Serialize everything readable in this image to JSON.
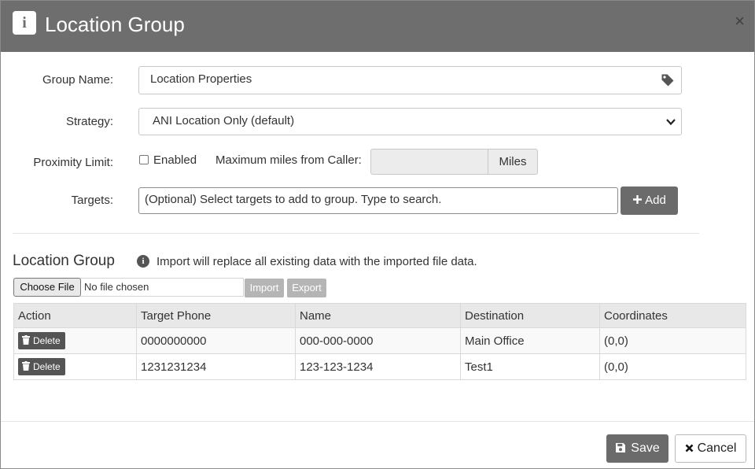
{
  "dialog": {
    "title": "Location Group",
    "header_icon": "info-icon",
    "close_glyph": "×"
  },
  "form": {
    "group_name_label": "Group Name:",
    "group_name_value": "Location Properties",
    "strategy_label": "Strategy:",
    "strategy_value": "ANI Location Only (default)",
    "proximity_label": "Proximity Limit:",
    "enabled_label": "Enabled",
    "enabled_checked": false,
    "max_miles_label": "Maximum miles from Caller:",
    "max_miles_value": "",
    "miles_addon": "Miles",
    "targets_label": "Targets:",
    "targets_placeholder": "(Optional) Select targets to add to group. Type to search.",
    "add_label": "Add"
  },
  "section": {
    "title": "Location Group",
    "import_note": "Import will replace all existing data with the imported file data.",
    "choose_file_label": "Choose File",
    "no_file_text": "No file chosen",
    "import_label": "Import",
    "export_label": "Export"
  },
  "table": {
    "columns": [
      "Action",
      "Target Phone",
      "Name",
      "Destination",
      "Coordinates"
    ],
    "rows": [
      {
        "action": "Delete",
        "target_phone": "0000000000",
        "name": "000-000-0000",
        "destination": "Main Office",
        "coordinates": "(0,0)"
      },
      {
        "action": "Delete",
        "target_phone": "1231231234",
        "name": "123-123-1234",
        "destination": "Test1",
        "coordinates": "(0,0)"
      }
    ]
  },
  "footer": {
    "save_label": "Save",
    "cancel_label": "Cancel"
  },
  "colors": {
    "header_bg": "#6e6e6e",
    "button_dark": "#6b6b6b",
    "button_disabled": "#b5b5b5"
  }
}
